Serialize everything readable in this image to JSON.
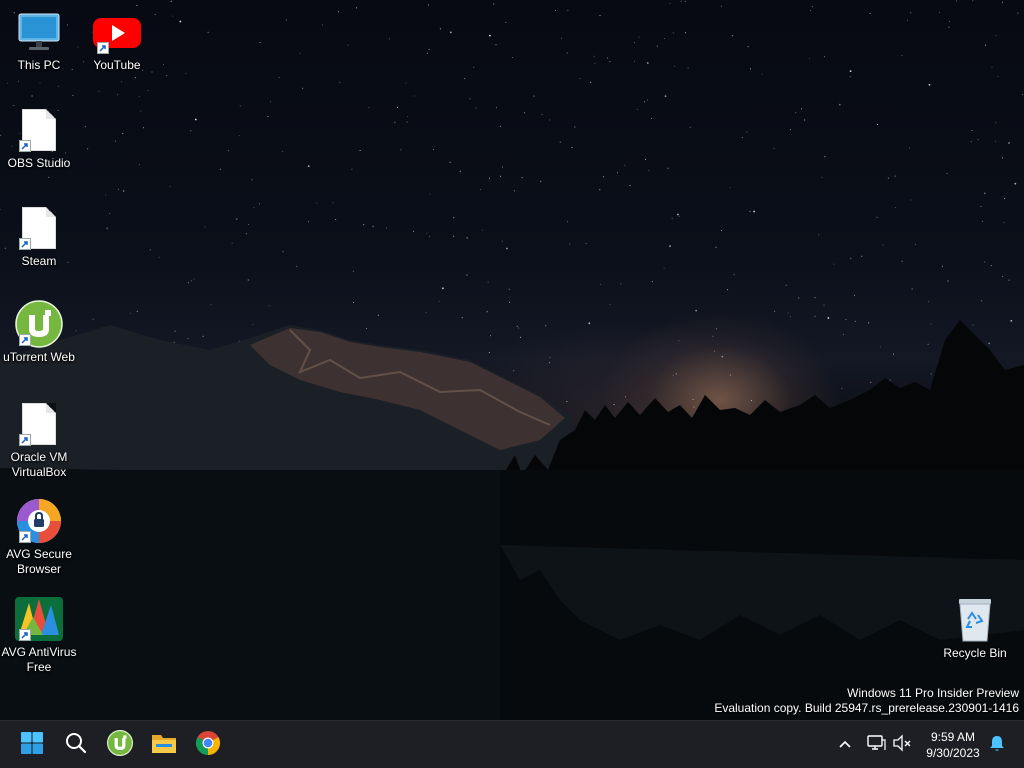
{
  "desktop": {
    "icons": [
      {
        "label": "This PC",
        "icon": "monitor-icon"
      },
      {
        "label": "YouTube",
        "icon": "youtube-icon"
      },
      {
        "label": "OBS Studio",
        "icon": "blank-file-icon"
      },
      {
        "label": "Steam",
        "icon": "blank-file-icon"
      },
      {
        "label": "uTorrent Web",
        "icon": "utorrent-icon"
      },
      {
        "label": "Oracle VM\nVirtualBox",
        "icon": "blank-file-icon"
      },
      {
        "label": "AVG Secure\nBrowser",
        "icon": "avg-browser-icon"
      },
      {
        "label": "AVG AntiVirus\nFree",
        "icon": "avg-antivirus-icon"
      },
      {
        "label": "Recycle Bin",
        "icon": "recycle-bin-icon"
      }
    ],
    "watermark": {
      "line1": "Windows 11 Pro Insider Preview",
      "line2": "Evaluation copy. Build 25947.rs_prerelease.230901-1416"
    }
  },
  "taskbar": {
    "apps": [
      "start-icon",
      "search-icon",
      "utorrent-icon",
      "file-explorer-icon",
      "chrome-icon"
    ],
    "tray": [
      "chevron-up-icon",
      "network-icon",
      "volume-muted-icon",
      "notification-bell-icon"
    ],
    "clock": {
      "time": "9:59 AM",
      "date": "9/30/2023"
    }
  },
  "colors": {
    "taskbar_bg": "#1d1f24",
    "accent": "#4cc2ff",
    "youtube_red": "#ff0000",
    "utorrent_green": "#76b83f"
  }
}
